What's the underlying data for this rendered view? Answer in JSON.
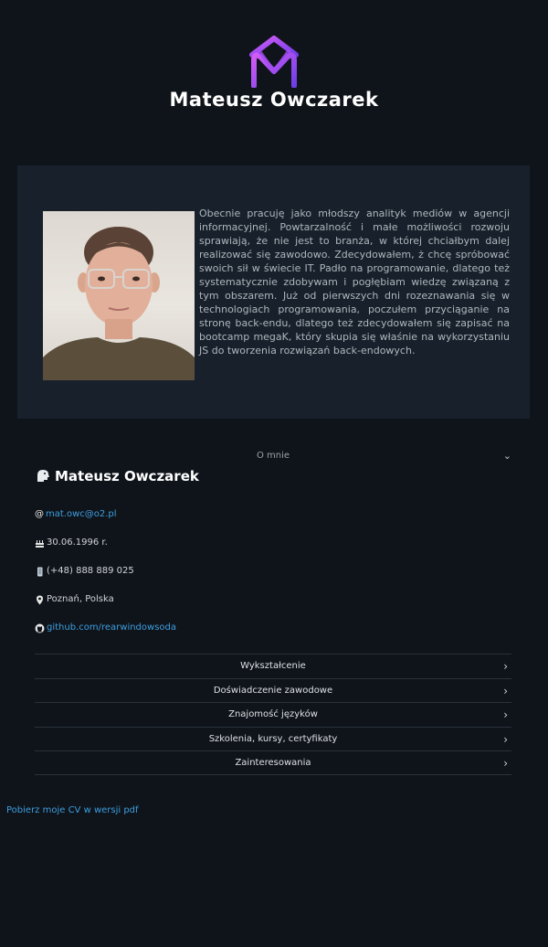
{
  "header": {
    "title": "Mateusz Owczarek",
    "logo_icon": "purple-m-logo"
  },
  "about": {
    "text": "Obecnie pracuję jako młodszy analityk mediów w agencji informacyjnej. Powtarzalność i małe możliwości rozwoju sprawiają, że nie jest to branża, w której chciałbym dalej realizować się zawodowo. Zdecydowałem, ż chcę spróbować swoich sił w świecie IT. Padło na programowanie, dlatego też systematycznie zdobywam i pogłębiam wiedzę związaną z tym obszarem. Już od pierwszych dni rozeznawania się w technologiach programowania, poczułem przyciąganie na stronę back-endu, dlatego też zdecydowałem się zapisać na bootcamp megaK, który skupia się właśnie na wykorzystaniu JS do tworzenia rozwiązań back-endowych."
  },
  "profile": {
    "section_label": "O mnie",
    "name": "Mateusz Owczarek",
    "email_prefix": "@",
    "email": "mat.owc@o2.pl",
    "birthdate": "30.06.1996 r.",
    "phone": "(+48) 888 889 025",
    "location": "Poznań, Polska",
    "github": "github.com/rearwindowsoda"
  },
  "accordion": {
    "items": [
      "Wykształcenie",
      "Doświadczenie zawodowe",
      "Znajomość języków",
      "Szkolenia, kursy, certyfikaty",
      "Zainteresowania"
    ]
  },
  "footer": {
    "download_link": "Pobierz moje CV w wersji pdf"
  },
  "colors": {
    "background": "#0f141a",
    "card": "#18212b",
    "link": "#3d9ee0",
    "logo_start": "#c154f5",
    "logo_end": "#7b3fe4"
  }
}
